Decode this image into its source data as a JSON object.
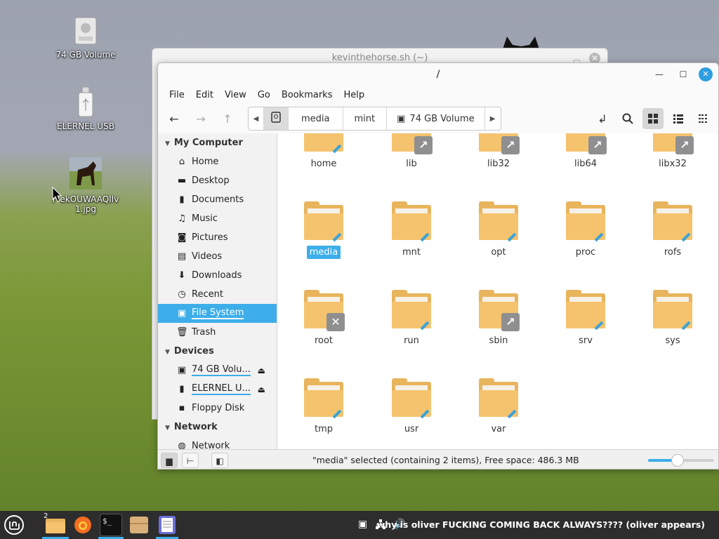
{
  "desktop": {
    "icons": [
      {
        "label": "74 GB Volume",
        "icon": "drive-icon"
      },
      {
        "label": "ELERNEL USB",
        "icon": "usb-drive-icon"
      },
      {
        "label": "F…ekOUWAAQIIv1.jpg",
        "label_line1": "F   ekOUWAAQIIv",
        "label_line2": "1.jpg",
        "icon": "image-thumbnail-icon"
      }
    ]
  },
  "back_window": {
    "title": "kevinthehorse.sh (~)"
  },
  "window": {
    "title": "/",
    "menu": [
      "File",
      "Edit",
      "View",
      "Go",
      "Bookmarks",
      "Help"
    ],
    "pathbar": [
      "media",
      "mint",
      "74 GB Volume"
    ],
    "sidebar": {
      "sections": [
        {
          "title": "My Computer",
          "items": [
            {
              "label": "Home",
              "icon": "home-icon"
            },
            {
              "label": "Desktop",
              "icon": "desktop-icon"
            },
            {
              "label": "Documents",
              "icon": "documents-icon"
            },
            {
              "label": "Music",
              "icon": "music-icon"
            },
            {
              "label": "Pictures",
              "icon": "camera-icon"
            },
            {
              "label": "Videos",
              "icon": "film-icon"
            },
            {
              "label": "Downloads",
              "icon": "download-icon"
            },
            {
              "label": "Recent",
              "icon": "clock-icon"
            },
            {
              "label": "File System",
              "icon": "drive-icon",
              "selected": true
            },
            {
              "label": "Trash",
              "icon": "trash-icon"
            }
          ]
        },
        {
          "title": "Devices",
          "items": [
            {
              "label": "74 GB Volu...",
              "icon": "chip-icon",
              "eject": true
            },
            {
              "label": "ELERNEL U...",
              "icon": "usb-icon",
              "eject": true
            },
            {
              "label": "Floppy Disk",
              "icon": "floppy-icon"
            }
          ]
        },
        {
          "title": "Network",
          "items": [
            {
              "label": "Network",
              "icon": "globe-icon"
            }
          ]
        }
      ]
    },
    "files": [
      {
        "name": "home",
        "emblem": ""
      },
      {
        "name": "lib",
        "emblem": "link"
      },
      {
        "name": "lib32",
        "emblem": "link"
      },
      {
        "name": "lib64",
        "emblem": "link"
      },
      {
        "name": "libx32",
        "emblem": "link"
      },
      {
        "name": "media",
        "emblem": "",
        "selected": true
      },
      {
        "name": "mnt",
        "emblem": ""
      },
      {
        "name": "opt",
        "emblem": ""
      },
      {
        "name": "proc",
        "emblem": ""
      },
      {
        "name": "rofs",
        "emblem": ""
      },
      {
        "name": "root",
        "emblem": "no-access"
      },
      {
        "name": "run",
        "emblem": ""
      },
      {
        "name": "sbin",
        "emblem": "link"
      },
      {
        "name": "srv",
        "emblem": ""
      },
      {
        "name": "sys",
        "emblem": ""
      },
      {
        "name": "tmp",
        "emblem": ""
      },
      {
        "name": "usr",
        "emblem": ""
      },
      {
        "name": "var",
        "emblem": ""
      }
    ],
    "status": "\"media\" selected (containing 2 items), Free space: 486.3 MB",
    "zoom_level": 0.45
  },
  "taskbar": {
    "apps": [
      {
        "name": "files",
        "badge": "2"
      },
      {
        "name": "firefox"
      },
      {
        "name": "terminal"
      },
      {
        "name": "archive"
      },
      {
        "name": "text-editor"
      }
    ],
    "notification": "why is oliver FUCKING COMING BACK ALWAYS???? (oliver appears)"
  }
}
